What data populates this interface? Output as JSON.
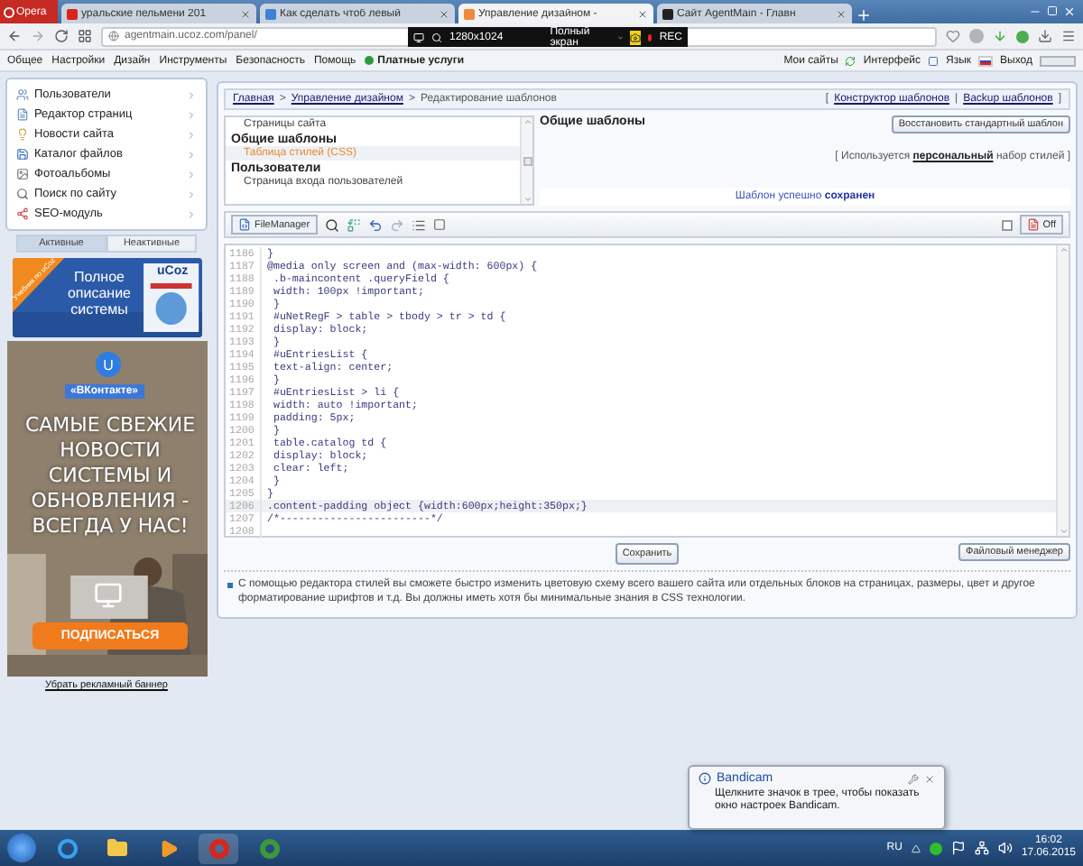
{
  "browser": {
    "menu_label": "Opera",
    "address": "agentmain.ucoz.com/panel/",
    "tabs": [
      {
        "title": "уральские пельмени 201",
        "selected": false
      },
      {
        "title": "Как сделать чтоб левый",
        "selected": false
      },
      {
        "title": "Управление дизайном -",
        "selected": true
      },
      {
        "title": "Сайт AgentMain - Главн",
        "selected": false
      }
    ]
  },
  "recorder": {
    "resolution": "1280x1024",
    "mode": "Полный экран",
    "rec": "REC"
  },
  "menu": {
    "items": [
      "Общее",
      "Настройки",
      "Дизайн",
      "Инструменты",
      "Безопасность",
      "Помощь"
    ],
    "paid": "Платные услуги",
    "right": [
      "Мои сайты",
      "Интерфейс",
      "Язык",
      "Выход"
    ]
  },
  "sidebar": {
    "items": [
      {
        "label": "Пользователи",
        "kind": "users"
      },
      {
        "label": "Редактор страниц",
        "kind": "page"
      },
      {
        "label": "Новости сайта",
        "kind": "news"
      },
      {
        "label": "Каталог файлов",
        "kind": "files"
      },
      {
        "label": "Фотоальбомы"
      },
      {
        "label": "Поиск по сайту",
        "kind": "search"
      },
      {
        "label": "SEO-модуль",
        "kind": "seo"
      }
    ],
    "tabs": [
      {
        "label": "Активные",
        "selected": true
      },
      {
        "label": "Неактивные",
        "selected": false
      }
    ],
    "banner": {
      "ribbon": "Учебник по uCoz",
      "headline": "Полное описание системы",
      "box": "uCoz"
    },
    "promo": {
      "logo": "U",
      "badge": "«ВКонтакте»",
      "headline": "САМЫЕ СВЕЖИЕ НОВОСТИ СИСТЕМЫ И ОБНОВЛЕНИЯ - ВСЕГДА У НАС!",
      "button": "ПОДПИСАТЬСЯ"
    },
    "remove_link": "Убрать рекламный баннер"
  },
  "breadcrumb": {
    "items": [
      "Главная",
      "Управление дизайном",
      "Редактирование шаблонов"
    ],
    "separator": ">",
    "open": "[",
    "divider": "|",
    "close": "]",
    "links": [
      "Конструктор шаблонов",
      "Backup шаблонов"
    ]
  },
  "templates": [
    {
      "kind": "item",
      "label": "Страницы сайта",
      "selected": false
    },
    {
      "kind": "group",
      "label": "Общие шаблоны"
    },
    {
      "kind": "item",
      "label": "Таблица стилей (CSS)",
      "selected": true
    },
    {
      "kind": "group",
      "label": "Пользователи"
    },
    {
      "kind": "item",
      "label": "Страница входа пользователей",
      "selected": false
    }
  ],
  "template_panel": {
    "title": "Общие шаблоны",
    "restore_button": "Восстановить стандартный шаблон",
    "notice": "[ Используется **персональный** набор стилей ]",
    "status": "Шаблон успешно **сохранен**"
  },
  "toolbar": {
    "file_manager": "FileManager",
    "wrap_checked": false,
    "off": "Off"
  },
  "code": [
    {
      "number": "1186",
      "text": "}",
      "current": false
    },
    {
      "number": "1187",
      "text": "@media only screen and (max-width: 600px) {",
      "current": false
    },
    {
      "number": "1188",
      "text": " .b-maincontent .queryField {",
      "current": false
    },
    {
      "number": "1189",
      "text": " width: 100px !important;",
      "current": false
    },
    {
      "number": "1190",
      "text": " }",
      "current": false
    },
    {
      "number": "1191",
      "text": " #uNetRegF > table > tbody > tr > td {",
      "current": false
    },
    {
      "number": "1192",
      "text": " display: block;",
      "current": false
    },
    {
      "number": "1193",
      "text": " }",
      "current": false
    },
    {
      "number": "1194",
      "text": " #uEntriesList {",
      "current": false
    },
    {
      "number": "1195",
      "text": " text-align: center;",
      "current": false
    },
    {
      "number": "1196",
      "text": " }",
      "current": false
    },
    {
      "number": "1197",
      "text": " #uEntriesList > li {",
      "current": false
    },
    {
      "number": "1198",
      "text": " width: auto !important;",
      "current": false
    },
    {
      "number": "1199",
      "text": " padding: 5px;",
      "current": false
    },
    {
      "number": "1200",
      "text": " }",
      "current": false
    },
    {
      "number": "1201",
      "text": " table.catalog td {",
      "current": false
    },
    {
      "number": "1202",
      "text": " display: block;",
      "current": false
    },
    {
      "number": "1203",
      "text": " clear: left;",
      "current": false
    },
    {
      "number": "1204",
      "text": " }",
      "current": false
    },
    {
      "number": "1205",
      "text": "}",
      "current": false
    },
    {
      "number": "1206",
      "text": ".content-padding object {width:600px;height:350px;}",
      "current": true
    },
    {
      "number": "1207",
      "text": "/*------------------------*/",
      "current": false
    },
    {
      "number": "1208",
      "current": false
    }
  ],
  "buttons": {
    "save": "Сохранить",
    "file_manager": "Файловый менеджер"
  },
  "note": "С помощью редактора стилей вы сможете быстро изменить цветовую схему всего вашего сайта или отдельных блоков на страницах, размеры, цвет и другое форматирование шрифтов и т.д. Вы должны иметь хотя бы минимальные знания в CSS технологии.",
  "notification": {
    "title": "Bandicam",
    "text": "Щелкните значок в трее, чтобы показать окно настроек Bandicam."
  },
  "taskbar": {
    "language": "RU",
    "time": "16:02",
    "date": "17.06.2015"
  }
}
